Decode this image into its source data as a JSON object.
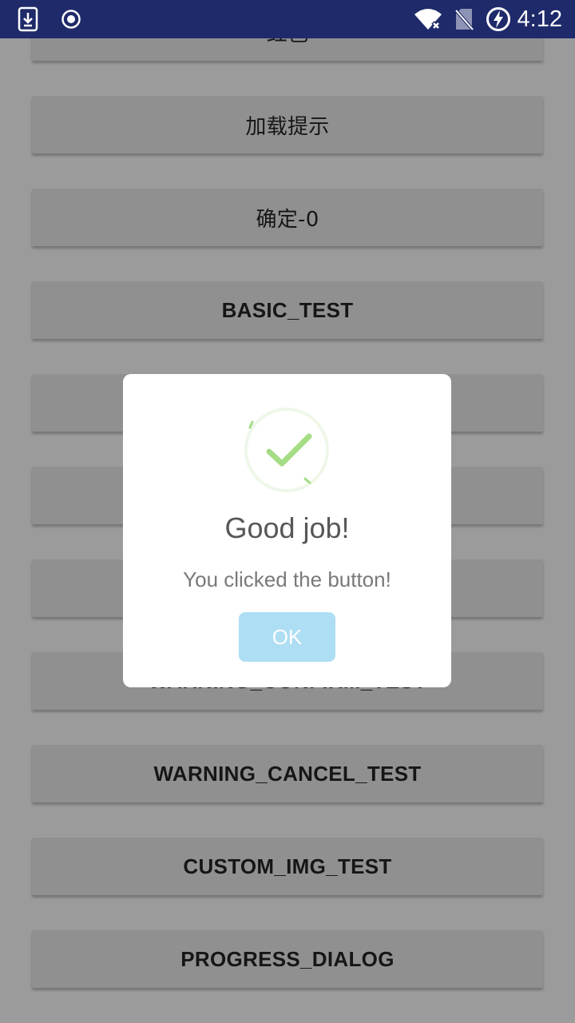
{
  "status_bar": {
    "time": "4:12",
    "icons": [
      "download-icon",
      "record-icon",
      "wifi-icon",
      "no-sim-icon",
      "battery-charging-icon"
    ]
  },
  "buttons": [
    {
      "label": "红色",
      "cjk": true
    },
    {
      "label": "加载提示",
      "cjk": true
    },
    {
      "label": "确定-0",
      "cjk": true
    },
    {
      "label": "BASIC_TEST",
      "cjk": false
    },
    {
      "label": "",
      "cjk": false
    },
    {
      "label": "",
      "cjk": false
    },
    {
      "label": "",
      "cjk": false
    },
    {
      "label": "WARNING_CONFIRM_TEST",
      "cjk": false
    },
    {
      "label": "WARNING_CANCEL_TEST",
      "cjk": false
    },
    {
      "label": "CUSTOM_IMG_TEST",
      "cjk": false
    },
    {
      "label": "PROGRESS_DIALOG",
      "cjk": false
    }
  ],
  "dialog": {
    "icon": "success-check-icon",
    "title": "Good job!",
    "message": "You clicked the button!",
    "ok_label": "OK"
  },
  "colors": {
    "status_bar": "#1f2a6b",
    "check": "#a5dc86",
    "ok_button": "#aedef4"
  }
}
